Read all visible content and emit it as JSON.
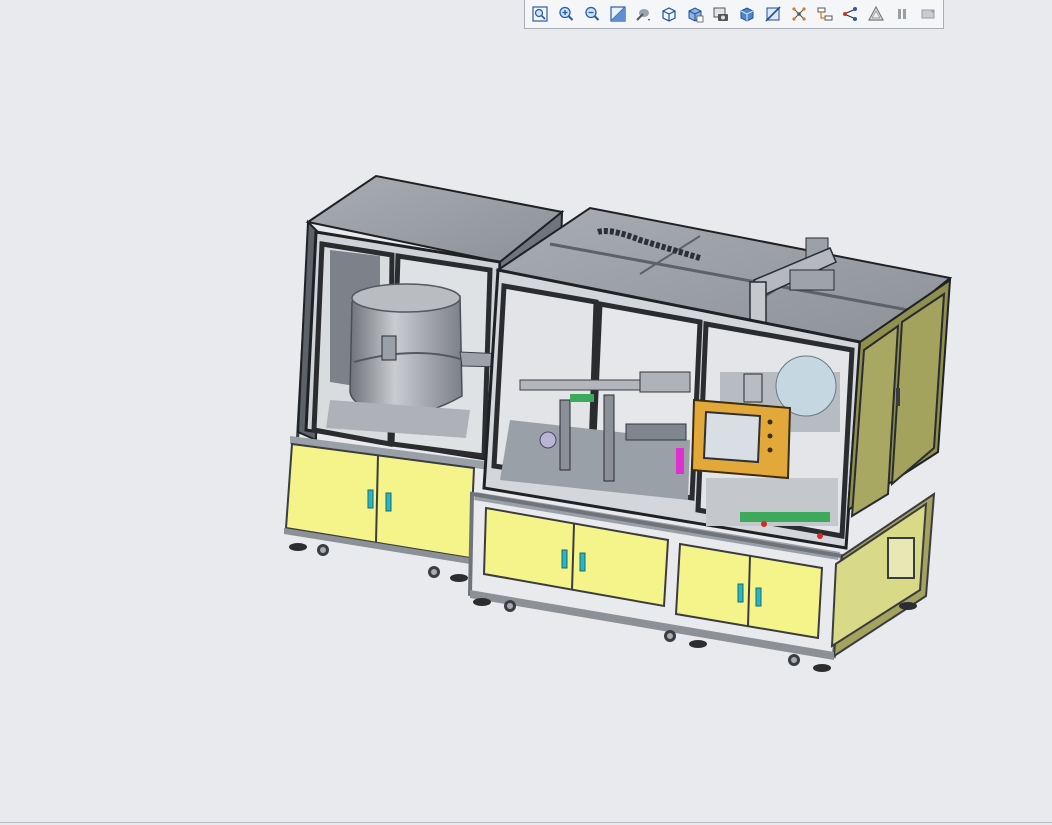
{
  "toolbar": {
    "buttons": [
      {
        "name": "zoom-to-fit-icon"
      },
      {
        "name": "zoom-in-icon"
      },
      {
        "name": "zoom-out-icon"
      },
      {
        "name": "zoom-area-icon"
      },
      {
        "name": "render-style-icon"
      },
      {
        "name": "view-cube-icon"
      },
      {
        "name": "standard-views-icon"
      },
      {
        "name": "camera-views-icon"
      },
      {
        "name": "shaded-box-icon"
      },
      {
        "name": "section-view-icon"
      },
      {
        "name": "explode-icon"
      },
      {
        "name": "tree-view-icon"
      },
      {
        "name": "network-icon"
      },
      {
        "name": "measure-icon"
      },
      {
        "name": "pause-icon"
      },
      {
        "name": "presentation-icon"
      }
    ]
  },
  "colors": {
    "background": "#e8eaee",
    "frame_dark": "#2a2c30",
    "panel_gray": "#a7abb2",
    "cabinet_yellow": "#f4f48a",
    "accent_orange": "#e2a93a",
    "handle_cyan": "#27b7c4"
  }
}
